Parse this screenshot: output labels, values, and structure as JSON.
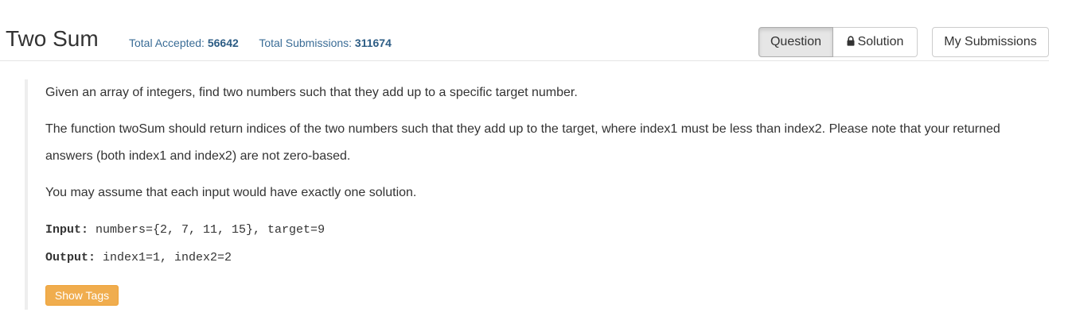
{
  "problem": {
    "title": "Two Sum",
    "accepted_label": "Total Accepted:",
    "accepted_value": "56642",
    "submissions_label": "Total Submissions:",
    "submissions_value": "311674"
  },
  "tabs": {
    "question_label": "Question",
    "solution_label": "Solution",
    "solution_icon": "lock-icon",
    "my_submissions_label": "My Submissions"
  },
  "description": {
    "paragraphs": [
      "Given an array of integers, find two numbers such that they add up to a specific target number.",
      "The function twoSum should return indices of the two numbers such that they add up to the target, where index1 must be less than index2. Please note that your returned answers (both index1 and index2) are not zero-based.",
      "You may assume that each input would have exactly one solution."
    ],
    "input_label": "Input:",
    "input_value": " numbers={2, 7, 11, 15}, target=9",
    "output_label": "Output:",
    "output_value": " index1=1, index2=2"
  },
  "tags_button_label": "Show Tags",
  "colors": {
    "stats_text": "#3a6c96",
    "tags_button": "#f0ad4e",
    "active_tab_bg": "#e6e6e6"
  }
}
